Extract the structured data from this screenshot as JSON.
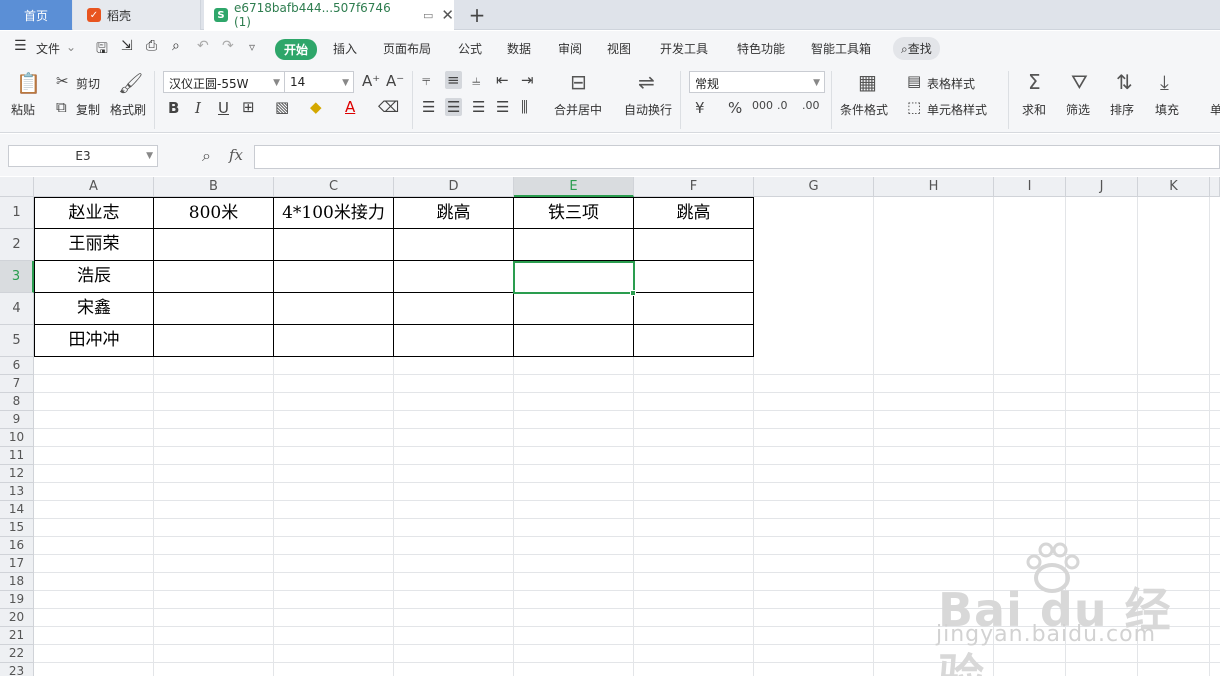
{
  "tabs": {
    "home": "首页",
    "daoke": "稻壳",
    "doc": "e6718bafb444...507f6746 (1)",
    "new_tab": "+"
  },
  "menu": {
    "file": "文件",
    "items": [
      "开始",
      "插入",
      "页面布局",
      "公式",
      "数据",
      "审阅",
      "视图",
      "开发工具",
      "特色功能",
      "智能工具箱"
    ],
    "find": "查找"
  },
  "ribbon": {
    "paste": "粘贴",
    "cut": "剪切",
    "copy": "复制",
    "format_painter": "格式刷",
    "font_name": "汉仪正圆-55W",
    "font_size": "14",
    "merge_center": "合并居中",
    "wrap_text": "自动换行",
    "number_format": "常规",
    "conditional_format": "条件格式",
    "table_style": "表格样式",
    "cell_style": "单元格样式",
    "sum": "求和",
    "filter": "筛选",
    "sort": "排序",
    "fill": "填充",
    "more": "单"
  },
  "formula_bar": {
    "name_box": "E3",
    "fx": "fx",
    "value": ""
  },
  "columns": [
    "A",
    "B",
    "C",
    "D",
    "E",
    "F",
    "G",
    "H",
    "I",
    "J",
    "K"
  ],
  "rows": [
    "1",
    "2",
    "3",
    "4",
    "5",
    "6",
    "7",
    "8",
    "9",
    "10",
    "11",
    "12",
    "13",
    "14",
    "15",
    "16",
    "17",
    "18",
    "19",
    "20",
    "21",
    "22",
    "23"
  ],
  "active_cell": "E3",
  "cells": [
    [
      "赵业志",
      "800米",
      "4*100米接力",
      "跳高",
      "铁三项",
      "跳高"
    ],
    [
      "王丽荣",
      "",
      "",
      "",
      "",
      ""
    ],
    [
      "浩辰",
      "",
      "",
      "",
      "",
      ""
    ],
    [
      "宋鑫",
      "",
      "",
      "",
      "",
      ""
    ],
    [
      "田冲冲",
      "",
      "",
      "",
      "",
      ""
    ]
  ],
  "watermark": {
    "brand": "Bai du 经验",
    "url": "jingyan.baidu.com"
  },
  "colors": {
    "accent": "#2ea66a",
    "selection": "#2a9d4f",
    "home_tab": "#5b8fd6"
  }
}
